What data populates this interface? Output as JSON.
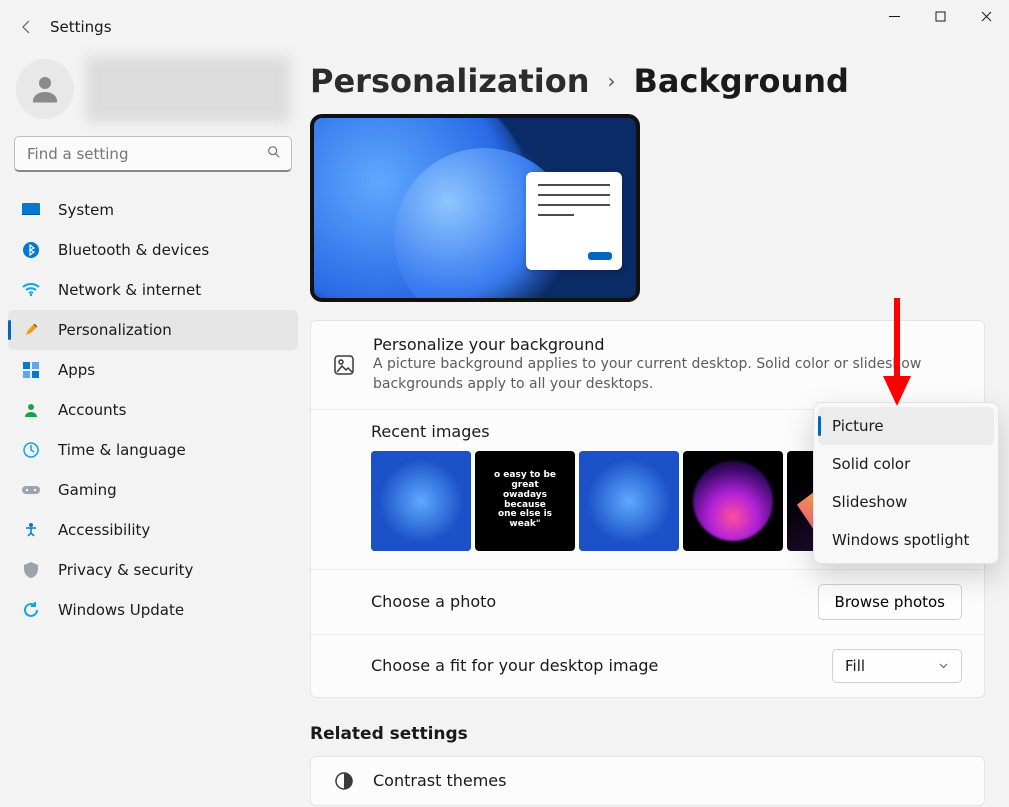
{
  "window": {
    "title": "Settings"
  },
  "search": {
    "placeholder": "Find a setting"
  },
  "sidebar": {
    "items": [
      {
        "label": "System"
      },
      {
        "label": "Bluetooth & devices"
      },
      {
        "label": "Network & internet"
      },
      {
        "label": "Personalization"
      },
      {
        "label": "Apps"
      },
      {
        "label": "Accounts"
      },
      {
        "label": "Time & language"
      },
      {
        "label": "Gaming"
      },
      {
        "label": "Accessibility"
      },
      {
        "label": "Privacy & security"
      },
      {
        "label": "Windows Update"
      }
    ]
  },
  "breadcrumb": {
    "parent": "Personalization",
    "sep": "›",
    "current": "Background"
  },
  "bg_section": {
    "title": "Personalize your background",
    "desc": "A picture background applies to your current desktop. Solid color or slideshow backgrounds apply to all your desktops."
  },
  "recent": {
    "title": "Recent images"
  },
  "choose_photo": {
    "label": "Choose a photo",
    "button": "Browse photos"
  },
  "choose_fit": {
    "label": "Choose a fit for your desktop image",
    "value": "Fill"
  },
  "dropdown": {
    "options": [
      {
        "label": "Picture"
      },
      {
        "label": "Solid color"
      },
      {
        "label": "Slideshow"
      },
      {
        "label": "Windows spotlight"
      }
    ]
  },
  "related": {
    "title": "Related settings",
    "contrast": "Contrast themes"
  }
}
